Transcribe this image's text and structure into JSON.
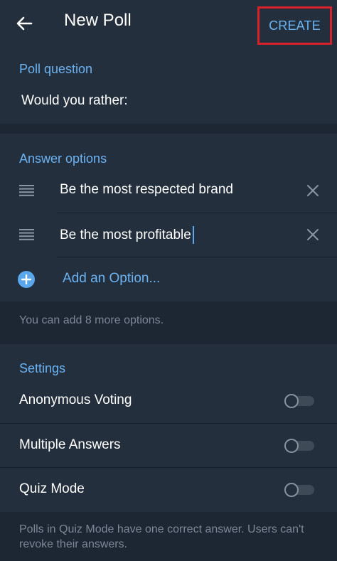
{
  "header": {
    "title": "New Poll",
    "create_label": "CREATE"
  },
  "question": {
    "section_title": "Poll question",
    "value": "Would you rather:"
  },
  "answers": {
    "section_title": "Answer options",
    "options": [
      {
        "text": "Be the most respected brand"
      },
      {
        "text": "Be the most profitable",
        "focused": true
      }
    ],
    "add_label": "Add an Option...",
    "remaining_note": "You can add 8 more options."
  },
  "settings": {
    "section_title": "Settings",
    "items": [
      {
        "label": "Anonymous Voting",
        "enabled": false
      },
      {
        "label": "Multiple Answers",
        "enabled": false
      },
      {
        "label": "Quiz Mode",
        "enabled": false
      }
    ],
    "footer_note": "Polls in Quiz Mode have one correct answer. Users can't revoke their answers."
  },
  "colors": {
    "background": "#1d2733",
    "panel": "#242f3d",
    "accent": "#6ab3f3",
    "highlight_border": "#d8202b",
    "muted_text": "#7b8796"
  },
  "icons": [
    "back-arrow-icon",
    "drag-handle-icon",
    "close-icon",
    "plus-circle-icon"
  ]
}
